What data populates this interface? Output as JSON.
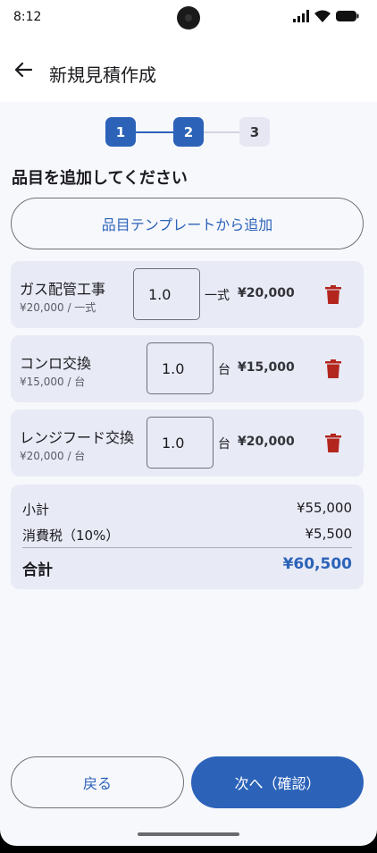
{
  "status_bar": {
    "time": "8:12"
  },
  "app_bar": {
    "title": "新規見積作成"
  },
  "stepper": {
    "steps": [
      "1",
      "2",
      "3"
    ],
    "current": 2
  },
  "section_title": "品目を追加してください",
  "template_button_label": "品目テンプレートから追加",
  "items": [
    {
      "name": "ガス配管工事",
      "unit_price": "¥20,000 / 一式",
      "qty": "1.0",
      "unit": "一式",
      "price": "¥20,000"
    },
    {
      "name": "コンロ交換",
      "unit_price": "¥15,000 / 台",
      "qty": "1.0",
      "unit": "台",
      "price": "¥15,000"
    },
    {
      "name": "レンジフード交換",
      "unit_price": "¥20,000 / 台",
      "qty": "1.0",
      "unit": "台",
      "price": "¥20,000"
    }
  ],
  "totals": {
    "subtotal_label": "小計",
    "subtotal_value": "¥55,000",
    "tax_label": "消費税（10%）",
    "tax_value": "¥5,500",
    "total_label": "合計",
    "total_value": "¥60,500"
  },
  "buttons": {
    "back": "戻る",
    "next": "次へ（確認）"
  },
  "colors": {
    "primary": "#2c63b9",
    "delete": "#b3261e",
    "card": "#e8eaf5"
  }
}
